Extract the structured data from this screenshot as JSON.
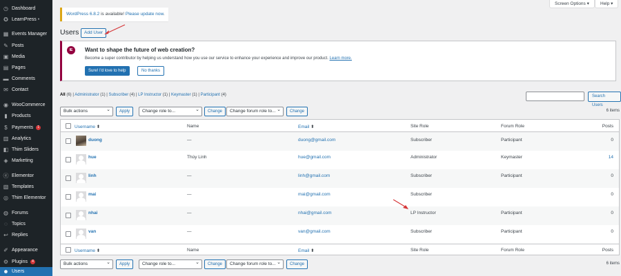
{
  "sidebar": {
    "items": [
      {
        "label": "Dashboard",
        "icon": "dashboard-icon",
        "glyph": "◷"
      },
      {
        "label": "LearnPress",
        "icon": "learnpress-icon",
        "glyph": "✪",
        "dot": "•"
      },
      {
        "label": "Events Manager",
        "icon": "calendar-icon",
        "glyph": "▦"
      },
      {
        "label": "Posts",
        "icon": "pin-icon",
        "glyph": "✎"
      },
      {
        "label": "Media",
        "icon": "media-icon",
        "glyph": "▣"
      },
      {
        "label": "Pages",
        "icon": "pages-icon",
        "glyph": "▤"
      },
      {
        "label": "Comments",
        "icon": "comments-icon",
        "glyph": "▬"
      },
      {
        "label": "Contact",
        "icon": "envelope-icon",
        "glyph": "✉"
      },
      {
        "label": "WooCommerce",
        "icon": "woocommerce-icon",
        "glyph": "◉"
      },
      {
        "label": "Products",
        "icon": "products-icon",
        "glyph": "▮"
      },
      {
        "label": "Payments",
        "icon": "payments-icon",
        "glyph": "$",
        "badge": "1"
      },
      {
        "label": "Analytics",
        "icon": "analytics-icon",
        "glyph": "▥"
      },
      {
        "label": "Thim Sliders",
        "icon": "sliders-icon",
        "glyph": "◧"
      },
      {
        "label": "Marketing",
        "icon": "megaphone-icon",
        "glyph": "◈"
      },
      {
        "label": "Elementor",
        "icon": "elementor-icon",
        "glyph": "ⓔ"
      },
      {
        "label": "Templates",
        "icon": "templates-icon",
        "glyph": "▧"
      },
      {
        "label": "Thim Elementor",
        "icon": "thim-elementor-icon",
        "glyph": "◎"
      },
      {
        "label": "Forums",
        "icon": "forums-icon",
        "glyph": "◍"
      },
      {
        "label": "Topics",
        "icon": "topics-icon",
        "glyph": "◌"
      },
      {
        "label": "Replies",
        "icon": "replies-icon",
        "glyph": "↩"
      },
      {
        "label": "Appearance",
        "icon": "paintbrush-icon",
        "glyph": "✐"
      },
      {
        "label": "Plugins",
        "icon": "plugins-icon",
        "glyph": "⚙",
        "badge": "4"
      },
      {
        "label": "Users",
        "icon": "users-icon",
        "glyph": "☻"
      }
    ]
  },
  "top": {
    "screen_options": "Screen Options ▾",
    "help": "Help ▾"
  },
  "notice": {
    "link1": "WordPress 6.8.2",
    "mid": " is available! ",
    "link2": "Please update now",
    "end": "."
  },
  "page": {
    "title": "Users",
    "add_new": "Add User"
  },
  "promo": {
    "logo": "IE",
    "title": "Want to shape the future of web creation?",
    "body": "Become a super contributor by helping us understand how you use our service to enhance your experience and improve our product.",
    "learn_more": "Learn more.",
    "accept": "Sure! I'd love to help",
    "decline": "No thanks"
  },
  "filters": [
    {
      "label": "All",
      "count": "(6)"
    },
    {
      "label": "Administrator",
      "count": "(1)"
    },
    {
      "label": "Subscriber",
      "count": "(4)"
    },
    {
      "label": "LP Instructor",
      "count": "(1)"
    },
    {
      "label": "Keymaster",
      "count": "(1)"
    },
    {
      "label": "Participant",
      "count": "(4)"
    }
  ],
  "filter_sep": " | ",
  "search": {
    "button": "Search Users"
  },
  "bulk": {
    "actions": "Bulk actions",
    "apply": "Apply",
    "role": "Change role to...",
    "change": "Change",
    "forum_role": "Change forum role to...",
    "change2": "Change",
    "count": "6 items"
  },
  "table": {
    "columns": {
      "username": "Username",
      "name": "Name",
      "email": "Email",
      "site_role": "Site Role",
      "forum_role": "Forum Role",
      "posts": "Posts"
    },
    "sort_icon": "⬍",
    "rows": [
      {
        "username": "duong",
        "name": "—",
        "email": "duong@gmail.com",
        "site_role": "Subscriber",
        "forum_role": "Participant",
        "posts": "0"
      },
      {
        "username": "hue",
        "name": "Thùy Linh",
        "email": "hue@gmail.com",
        "site_role": "Administrator",
        "forum_role": "Keymaster",
        "posts": "14"
      },
      {
        "username": "linh",
        "name": "—",
        "email": "linh@gmail.com",
        "site_role": "Subscriber",
        "forum_role": "Participant",
        "posts": "0"
      },
      {
        "username": "mai",
        "name": "—",
        "email": "mai@gmail.com",
        "site_role": "Subscriber",
        "forum_role": "",
        "posts": "0"
      },
      {
        "username": "nhai",
        "name": "—",
        "email": "nhai@gmail.com",
        "site_role": "LP Instructor",
        "forum_role": "Participant",
        "posts": "0"
      },
      {
        "username": "van",
        "name": "—",
        "email": "van@gmail.com",
        "site_role": "Subscriber",
        "forum_role": "Participant",
        "posts": "0"
      }
    ]
  },
  "colors": {
    "accent": "#2271b1",
    "sidebar": "#1d2327",
    "annotation": "#d63638"
  }
}
